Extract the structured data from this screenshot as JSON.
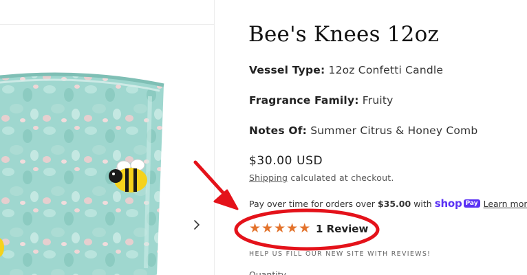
{
  "product": {
    "title": "Bee's Knees 12oz",
    "specs": [
      {
        "key": "Vessel Type:",
        "value": "12oz Confetti Candle"
      },
      {
        "key": "Fragrance Family:",
        "value": "Fruity"
      },
      {
        "key": "Notes Of:",
        "value": "Summer Citrus & Honey Comb"
      }
    ],
    "price": "$30.00 USD",
    "shipping_link": "Shipping",
    "shipping_text": "calculated at checkout."
  },
  "installments": {
    "prefix": "Pay over time for orders over",
    "amount": "$35.00",
    "suffix": "with",
    "brand": "shop",
    "brand_chip": "Pay",
    "learn_more": "Learn more",
    "brand_color": "#5a31f4"
  },
  "reviews": {
    "rating": 5,
    "max_rating": 5,
    "count_label": "1 Review",
    "star_color": "#e3732c",
    "help_text": "HELP US FILL OUR NEW SITE WITH REVIEWS!"
  },
  "quantity_label": "Quantity",
  "gallery": {
    "next_icon": "chevron-right-icon"
  },
  "annotation": {
    "color": "#e4121a"
  }
}
